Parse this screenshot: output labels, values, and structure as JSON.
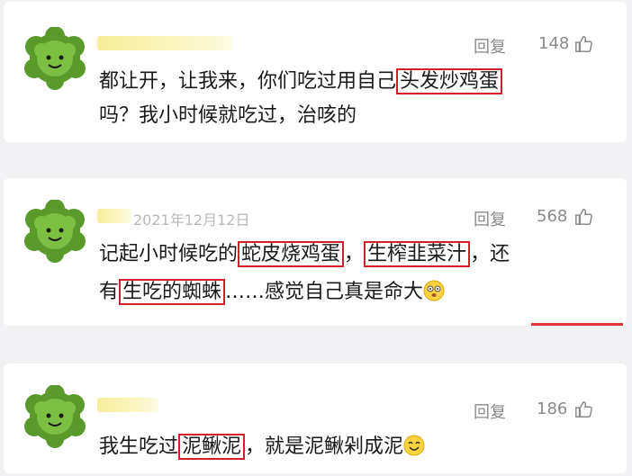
{
  "comments": [
    {
      "reply_label": "回复",
      "likes": "148",
      "line1_pre": "都让开，让我来，你们吃过用自己",
      "line1_hl": "头发炒鸡蛋",
      "line2": "吗？我小时候就吃过，治咳的"
    },
    {
      "date": "2021年12月12日",
      "reply_label": "回复",
      "likes": "568",
      "line1_pre": "记起小时候吃的",
      "line1_hl1": "蛇皮烧鸡蛋",
      "line1_mid": "，",
      "line1_hl2": "生榨韭菜汁",
      "line1_post": "，还",
      "line2_pre": "有",
      "line2_hl": "生吃的蜘蛛",
      "line2_post": "……感觉自己真是命大"
    },
    {
      "reply_label": "回复",
      "likes": "186",
      "line1_pre": "我生吃过",
      "line1_hl": "泥鳅泥",
      "line1_post": "，就是泥鳅剁成泥"
    }
  ],
  "icons": {
    "avatar": "green-plant-face-avatar",
    "thumb": "thumb-up-icon",
    "emoji1": "dizzy-face-emoji",
    "emoji2": "smiling-face-emoji"
  },
  "colors": {
    "highlight_border": "#d21f2b",
    "name_blur": "#f6ee9a"
  }
}
